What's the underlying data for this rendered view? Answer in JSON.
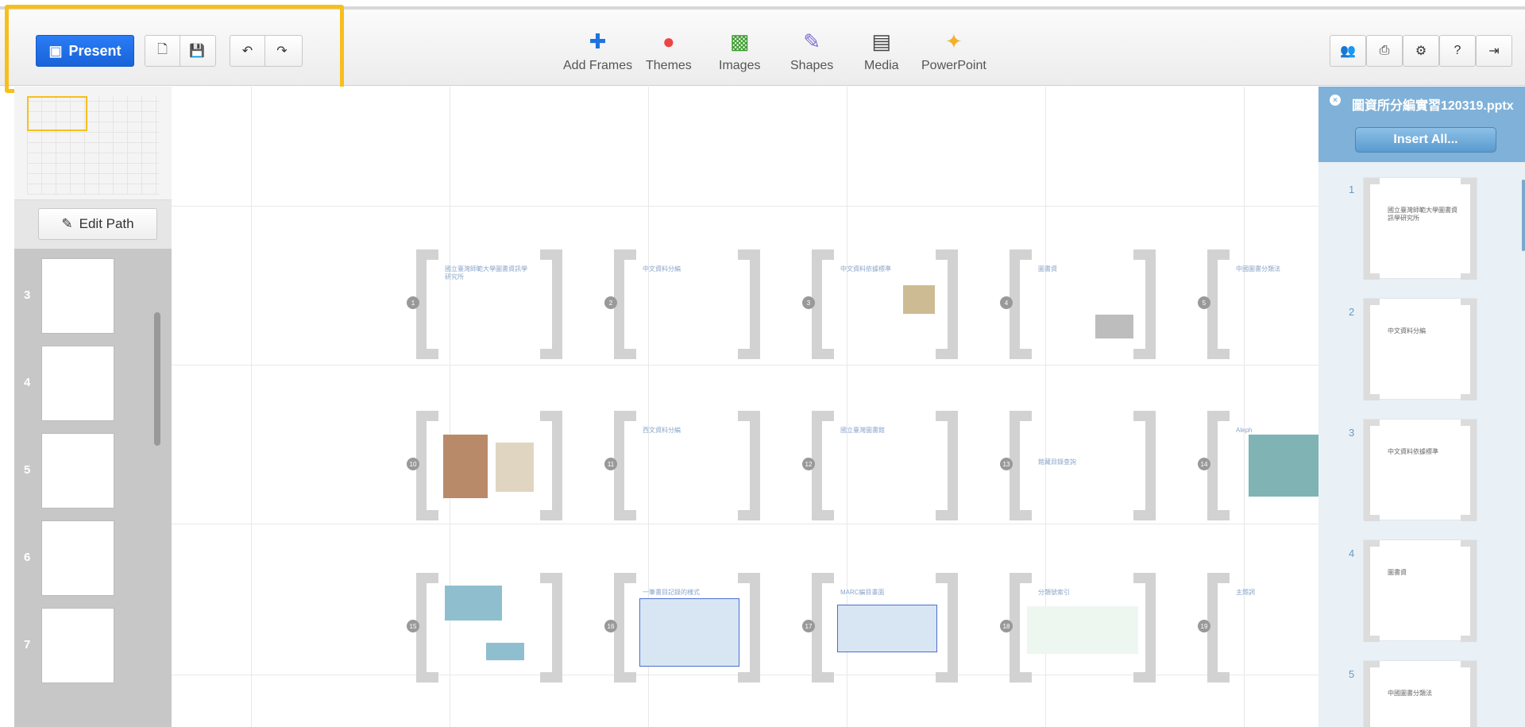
{
  "toolbar": {
    "present_label": "Present",
    "tools": [
      {
        "label": "Add Frames",
        "icon": "plus-icon",
        "color": "#1f73e0"
      },
      {
        "label": "Themes",
        "icon": "themes-icon",
        "color": "#e44"
      },
      {
        "label": "Images",
        "icon": "image-icon",
        "color": "#3a9b2c"
      },
      {
        "label": "Shapes",
        "icon": "shapes-icon",
        "color": "#7b6cd8"
      },
      {
        "label": "Media",
        "icon": "film-icon",
        "color": "#444"
      },
      {
        "label": "PowerPoint",
        "icon": "powerpoint-icon",
        "color": "#f3b12b"
      }
    ]
  },
  "left_panel": {
    "edit_path_label": "Edit Path",
    "thumbnails": [
      {
        "number": "3"
      },
      {
        "number": "4"
      },
      {
        "number": "5"
      },
      {
        "number": "6"
      },
      {
        "number": "7"
      }
    ]
  },
  "canvas": {
    "frames": [
      {
        "number": "1",
        "text": "國立臺灣師範大學圖書資訊學研究所"
      },
      {
        "number": "2",
        "text": "中文資料分編"
      },
      {
        "number": "3",
        "text": "中文資料依據標準"
      },
      {
        "number": "4",
        "text": "圖書資"
      },
      {
        "number": "5",
        "text": "中國圖書分類法"
      },
      {
        "number": "10",
        "text": ""
      },
      {
        "number": "11",
        "text": "西文資料分編"
      },
      {
        "number": "12",
        "text": "國立臺灣圖書館"
      },
      {
        "number": "13",
        "text": "館藏目錄查詢"
      },
      {
        "number": "14",
        "text": "Aleph"
      },
      {
        "number": "15",
        "text": ""
      },
      {
        "number": "16",
        "text": "一筆書目記錄的樣式"
      },
      {
        "number": "17",
        "text": "MARC編目畫面"
      },
      {
        "number": "18",
        "text": "分類號索引"
      },
      {
        "number": "19",
        "text": "主題詞"
      }
    ]
  },
  "right_panel": {
    "file_name": "圖資所分編實習120319.pptx",
    "insert_all_label": "Insert All...",
    "slides": [
      {
        "number": "1",
        "text": "國立臺灣師範大學圖書資訊學研究所"
      },
      {
        "number": "2",
        "text": "中文資料分編"
      },
      {
        "number": "3",
        "text": "中文資料依據標準"
      },
      {
        "number": "4",
        "text": "圖書資"
      },
      {
        "number": "5",
        "text": "中國圖書分類法"
      }
    ]
  }
}
